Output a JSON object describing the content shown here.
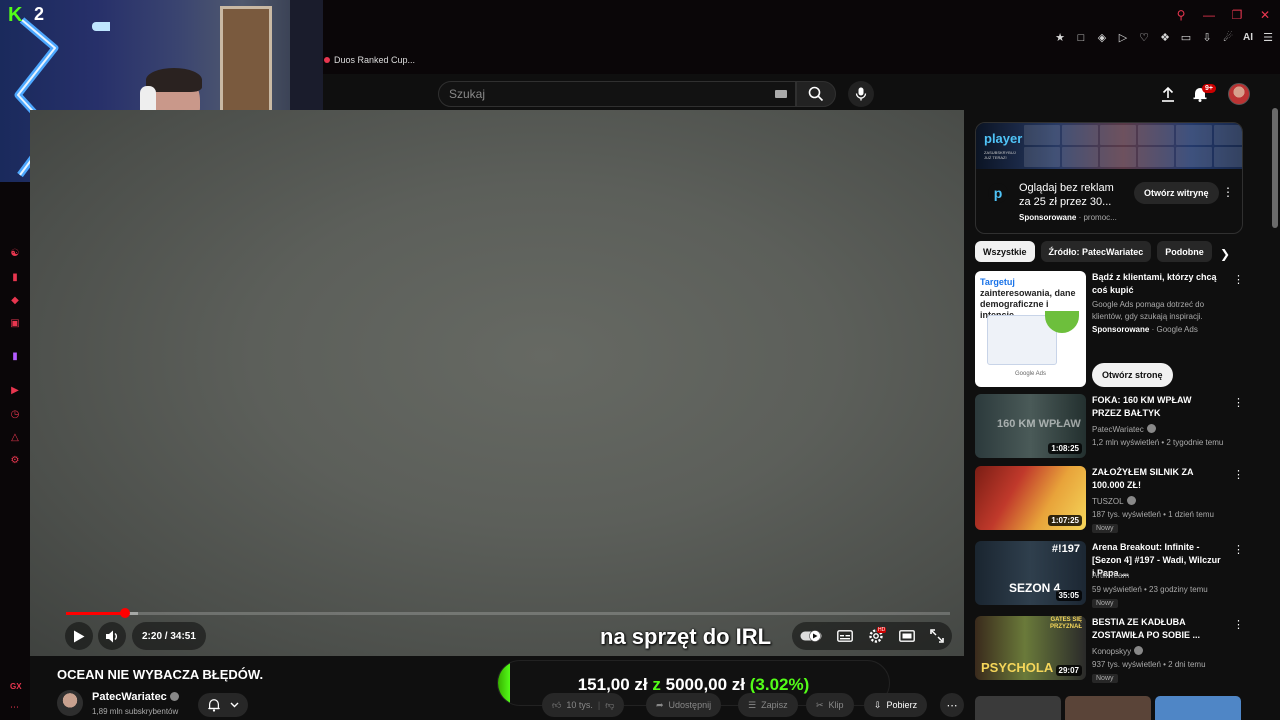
{
  "browser": {
    "tab_title": "Duos Ranked Cup...",
    "ai_label": "AI"
  },
  "webcam": {
    "logo": "K",
    "logo_number": "2"
  },
  "header": {
    "search_placeholder": "Szukaj",
    "notification_count": "9+"
  },
  "player": {
    "time": "2:20 / 34:51",
    "progress": 0.067,
    "buffered": 0.081,
    "overlay_text": "na sprzęt do IRL"
  },
  "donation_goal": {
    "current": "151,00 zł",
    "connector": "z",
    "target": "5000,00 zł",
    "percent": "(3.02%)",
    "fraction": 0.0302
  },
  "video": {
    "title": "OCEAN NIE WYBACZA BŁĘDÓW.",
    "channel": "PatecWariatec",
    "subscribers": "1,89 mln subskrybentów",
    "likes": "10 tys.",
    "share_label": "Udostępnij",
    "save_label": "Zapisz",
    "clip_label": "Klip",
    "download_label": "Pobierz"
  },
  "sidebar_ad": {
    "brand": "player",
    "brand_sub": "ZASUBSKRYBUJ JUŻ TERAZ!",
    "title": "Oglądaj bez reklam za 25 zł przez 30...",
    "sponsored": "Sponsorowane",
    "meta_tail": "· promoc...",
    "button": "Otwórz witrynę"
  },
  "chips": [
    "Wszystkie",
    "Źródło: PatecWariatec",
    "Podobne"
  ],
  "google_ad": {
    "thumb_highlight": "Targetuj",
    "thumb_text": "zainteresowania, dane demograficzne i intencje",
    "thumb_footer": "Google Ads",
    "title": "Bądź z klientami, którzy chcą coś kupić",
    "description": "Google Ads pomaga dotrzeć do klientów, gdy szukają inspiracji.",
    "sponsored": "Sponsorowane",
    "advertiser": "· Google Ads",
    "button": "Otwórz stronę"
  },
  "recommendations": [
    {
      "title": "FOKA: 160 KM WPŁAW PRZEZ BAŁTYK",
      "channel": "PatecWariatec",
      "views": "1,2 mln wyświetleń • 2 tygodnie temu",
      "duration": "1:08:25",
      "thumb_text": "160 KM WPŁAW",
      "new": ""
    },
    {
      "title": "ZAŁOŻYŁEM SILNIK ZA 100.000 ZŁ!",
      "channel": "TUSZOL",
      "views": "187 tys. wyświetleń • 1 dzień temu",
      "duration": "1:07:25",
      "thumb_text": "",
      "new": "Nowy"
    },
    {
      "title": "Arena Breakout: Infinite - [Sezon 4] #197 - Wadi, Wilczur i Papa ...",
      "channel": "Artill Team",
      "views": "59 wyświetleń • 23 godziny temu",
      "duration": "35:05",
      "thumb_text": "SEZON 4",
      "thumb_text2": "#!197",
      "new": "Nowy"
    },
    {
      "title": "BESTIA ZE KADŁUBA ZOSTAWIŁA PO SOBIE ...",
      "channel": "Konopskyy",
      "views": "937 tys. wyświetleń • 2 dni temu",
      "duration": "29:07",
      "thumb_text": "PSYCHOLA",
      "thumb_text2": "GATES SIĘ PRZYZNAŁ",
      "new": "Nowy"
    }
  ]
}
